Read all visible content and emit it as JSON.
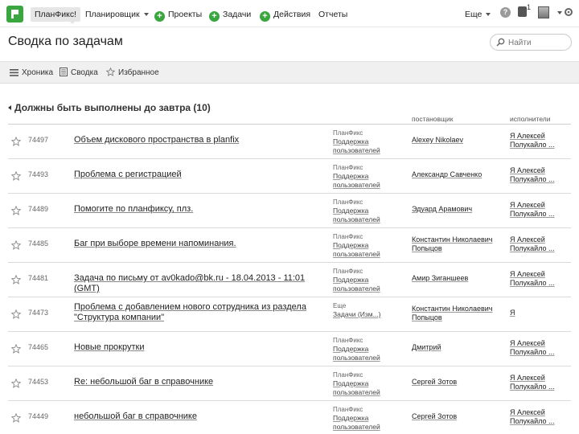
{
  "topnav": {
    "brand": "ПланФикс!",
    "planner": "Планировщик",
    "projects": "Проекты",
    "tasks": "Задачи",
    "actions": "Действия",
    "reports": "Отчеты",
    "more": "Еще",
    "help": "?",
    "notif_count": "1"
  },
  "header": {
    "title": "Сводка по задачам",
    "search_placeholder": "Найти"
  },
  "tabs": {
    "chronicle": "Хроника",
    "summary": "Сводка",
    "favorites": "Избранное"
  },
  "section": {
    "title": "Должны быть выполнены до завтра (10)",
    "col_assigner": "постановщик",
    "col_performers": "исполнители"
  },
  "tasks": [
    {
      "id": "74497",
      "title": "Объем дискового пространства в planfix",
      "proj_root": "ПланФикс",
      "project": "Поддержка пользователей",
      "assigner": "Alexey Nikolaev",
      "performers": "Я Алексей Полукайло ..."
    },
    {
      "id": "74493",
      "title": "Проблема с регистрацией",
      "proj_root": "ПланФикс",
      "project": "Поддержка пользователей",
      "assigner": "Александр Савченко",
      "performers": "Я Алексей Полукайло ..."
    },
    {
      "id": "74489",
      "title": "Помогите по планфиксу, плз.",
      "proj_root": "ПланФикс",
      "project": "Поддержка пользователей",
      "assigner": "Эдуард Арамович",
      "performers": "Я Алексей Полукайло ..."
    },
    {
      "id": "74485",
      "title": "Баг при выборе времени напоминания.",
      "proj_root": "ПланФикс",
      "project": "Поддержка пользователей",
      "assigner": "Константин Николаевич Попыцов",
      "performers": "Я Алексей Полукайло ..."
    },
    {
      "id": "74481",
      "title": "Задача по письму от av0kado@bk.ru - 18.04.2013 - 11:01 (GMT)",
      "proj_root": "ПланФикс",
      "project": "Поддержка пользователей",
      "assigner": "Амир Зиганшеев",
      "performers": "Я Алексей Полукайло ..."
    },
    {
      "id": "74473",
      "title": "Проблема с добавлением нового сотрудника из раздела \"Структура компании\"",
      "proj_root": "Еще",
      "project": "Задачи (Изм...)",
      "assigner": "Константин Николаевич Попыцов",
      "performers": "Я"
    },
    {
      "id": "74465",
      "title": "Новые прокрутки",
      "proj_root": "ПланФикс",
      "project": "Поддержка пользователей",
      "assigner": "Дмитрий",
      "performers": "Я Алексей Полукайло ..."
    },
    {
      "id": "74453",
      "title": "Re: небольшой баг в справочнике",
      "proj_root": "ПланФикс",
      "project": "Поддержка пользователей",
      "assigner": "Сергей Зотов",
      "performers": "Я Алексей Полукайло ..."
    },
    {
      "id": "74449",
      "title": "небольшой баг в справочнике",
      "proj_root": "ПланФикс",
      "project": "Поддержка пользователей",
      "assigner": "Сергей Зотов",
      "performers": "Я Алексей Полукайло ..."
    }
  ],
  "colors": {
    "brand_green": "#3aa63f",
    "tabs_bg": "#f0f0f0"
  }
}
